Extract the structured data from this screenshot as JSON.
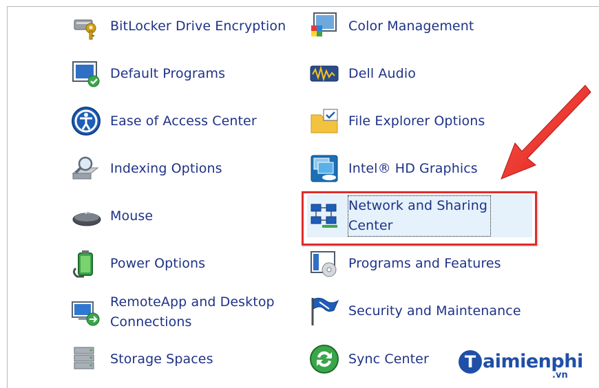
{
  "control_panel": {
    "left_column": [
      {
        "label": "BitLocker Drive Encryption",
        "icon": "bitlocker-icon"
      },
      {
        "label": "Default Programs",
        "icon": "default-programs-icon"
      },
      {
        "label": "Ease of Access Center",
        "icon": "ease-of-access-icon"
      },
      {
        "label": "Indexing Options",
        "icon": "indexing-options-icon"
      },
      {
        "label": "Mouse",
        "icon": "mouse-icon"
      },
      {
        "label": "Power Options",
        "icon": "power-options-icon"
      },
      {
        "label": "RemoteApp and Desktop Connections",
        "icon": "remoteapp-icon"
      },
      {
        "label": "Storage Spaces",
        "icon": "storage-spaces-icon"
      }
    ],
    "right_column": [
      {
        "label": "Color Management",
        "icon": "color-management-icon"
      },
      {
        "label": "Dell Audio",
        "icon": "dell-audio-icon"
      },
      {
        "label": "File Explorer Options",
        "icon": "file-explorer-options-icon"
      },
      {
        "label": "Intel® HD Graphics",
        "icon": "intel-graphics-icon"
      },
      {
        "label": "Network and Sharing Center",
        "icon": "network-sharing-icon",
        "selected": true
      },
      {
        "label": "Programs and Features",
        "icon": "programs-features-icon"
      },
      {
        "label": "Security and Maintenance",
        "icon": "security-maintenance-icon"
      },
      {
        "label": "Sync Center",
        "icon": "sync-center-icon"
      }
    ]
  },
  "labels": {
    "bitlocker": "BitLocker Drive Encryption",
    "default_programs": "Default Programs",
    "ease_of_access": "Ease of Access Center",
    "indexing": "Indexing Options",
    "mouse": "Mouse",
    "power": "Power Options",
    "remoteapp_line1": "RemoteApp and Desktop",
    "remoteapp_line2": "Connections",
    "storage": "Storage Spaces",
    "color_management": "Color Management",
    "dell_audio": "Dell Audio",
    "file_explorer": "File Explorer Options",
    "intel_graphics": "Intel® HD Graphics",
    "network_line1": "Network and Sharing",
    "network_line2": "Center",
    "programs_features": "Programs and Features",
    "security_maintenance": "Security and Maintenance",
    "sync_center": "Sync Center"
  },
  "annotation": {
    "highlight_color": "#e02b2b",
    "arrow_color": "#e02b2b"
  },
  "watermark": {
    "initial": "T",
    "text": "aimienphi",
    "sub": ".vn"
  },
  "colors": {
    "link_text": "#1e3287",
    "selection_bg": "#e5f1fb",
    "watermark": "#1f4fa7"
  }
}
